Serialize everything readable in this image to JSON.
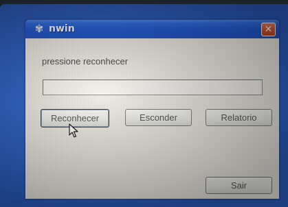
{
  "window": {
    "title": "nwin",
    "icon": "gear-icon",
    "close_glyph": "✕"
  },
  "form": {
    "prompt": "pressione reconhecer",
    "field_value": ""
  },
  "buttons": {
    "recognize": "Reconhecer",
    "hide": "Esconder",
    "report": "Relatorio",
    "exit": "Sair"
  },
  "colors": {
    "titlebar": "#1f58d4",
    "desktop": "#2d63c9",
    "close": "#d75a35",
    "window_bg": "#ece9e1"
  }
}
